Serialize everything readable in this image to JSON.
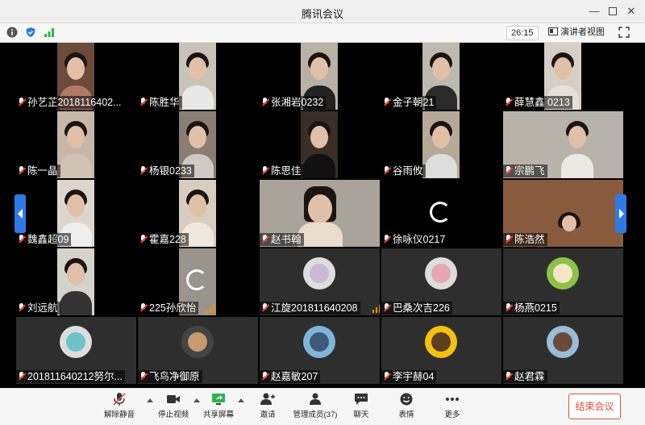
{
  "window": {
    "title": "腾讯会议"
  },
  "topbar": {
    "timer": "26:15",
    "speaker_view": "演讲者视图"
  },
  "participants": [
    {
      "name": "孙艺芷2018116402..."
    },
    {
      "name": "陈胜华"
    },
    {
      "name": "张湘岩0232"
    },
    {
      "name": "金子朝21"
    },
    {
      "name": "薛慧鑫 0213"
    },
    {
      "name": "陈一晶"
    },
    {
      "name": "杨银0233"
    },
    {
      "name": "陈思佳"
    },
    {
      "name": "谷雨攸"
    },
    {
      "name": "宗鹏飞"
    },
    {
      "name": "魏鑫超09"
    },
    {
      "name": "霍嘉228"
    },
    {
      "name": "赵书翰"
    },
    {
      "name": "徐咏仪0217"
    },
    {
      "name": "陈浩然"
    },
    {
      "name": "刘远航"
    },
    {
      "name": "225孙欣怡"
    },
    {
      "name": "江旋201811640208"
    },
    {
      "name": "巴桑次吉226"
    },
    {
      "name": "杨燕0215"
    },
    {
      "name": "201811640212努尔..."
    },
    {
      "name": "飞鸟净御原"
    },
    {
      "name": "赵嘉敏207"
    },
    {
      "name": "李宇赫04"
    },
    {
      "name": "赵君霖"
    }
  ],
  "toolbar": {
    "unmute": "解除静音",
    "stop_video": "停止视频",
    "share_screen": "共享屏幕",
    "invite": "邀请",
    "manage_members": "管理成员(37)",
    "chat": "聊天",
    "reactions": "表情",
    "more": "更多",
    "end_meeting": "结束会议"
  },
  "colors": {
    "accent": "#2f7be6",
    "danger": "#e74c3c",
    "signal": "#ff8a00"
  }
}
